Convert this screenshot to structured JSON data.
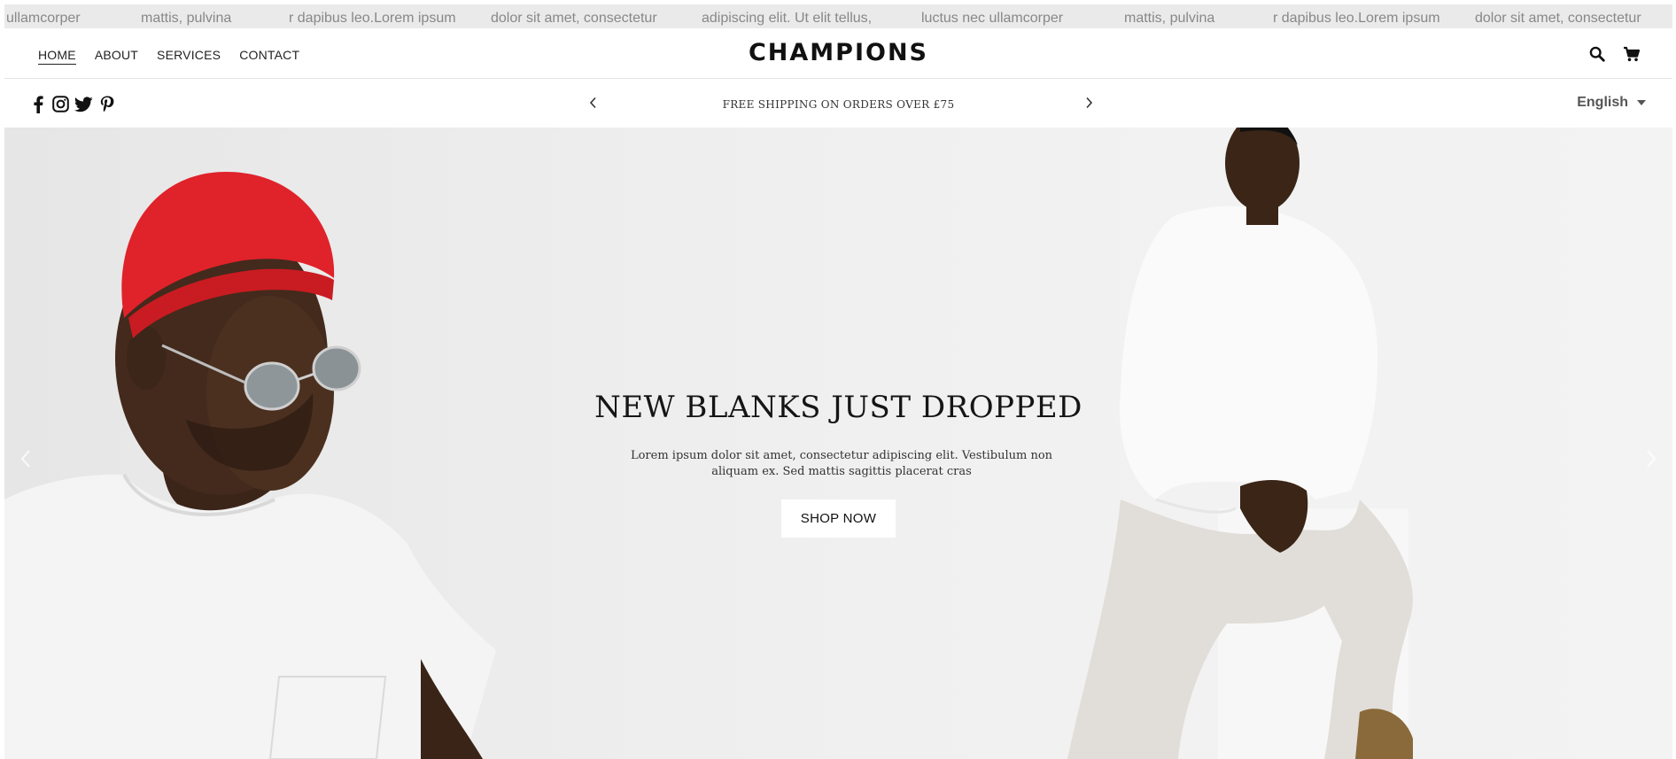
{
  "ticker": {
    "items": [
      "ullamcorper",
      "mattis, pulvina",
      "r dapibus leo.Lorem ipsum",
      "dolor sit amet, consectetur",
      "adipiscing elit. Ut elit tellus,",
      "luctus nec ullamcorper",
      "mattis, pulvina",
      "r dapibus leo.Lorem ipsum",
      "dolor sit amet, consectetur"
    ]
  },
  "header": {
    "nav": [
      "HOME",
      "ABOUT",
      "SERVICES",
      "CONTACT"
    ],
    "active_nav": "HOME",
    "logo": "CHAMPIONS",
    "icons": [
      "search-icon",
      "cart-icon"
    ]
  },
  "subbar": {
    "socials": [
      "facebook-icon",
      "instagram-icon",
      "twitter-icon",
      "pinterest-icon"
    ],
    "announcement": "FREE SHIPPING ON ORDERS OVER £75",
    "language": "English"
  },
  "hero": {
    "title": "NEW BLANKS JUST DROPPED",
    "text_line1": "Lorem ipsum dolor sit amet, consectetur adipiscing elit. Vestibulum non",
    "text_line2": "aliquam ex. Sed mattis sagittis placerat cras",
    "button": "SHOP NOW"
  },
  "colors": {
    "ticker_bg": "#eaeaea",
    "ticker_text": "#888888",
    "hat_red": "#e0222a",
    "hero_bg": "#eeeeee"
  }
}
